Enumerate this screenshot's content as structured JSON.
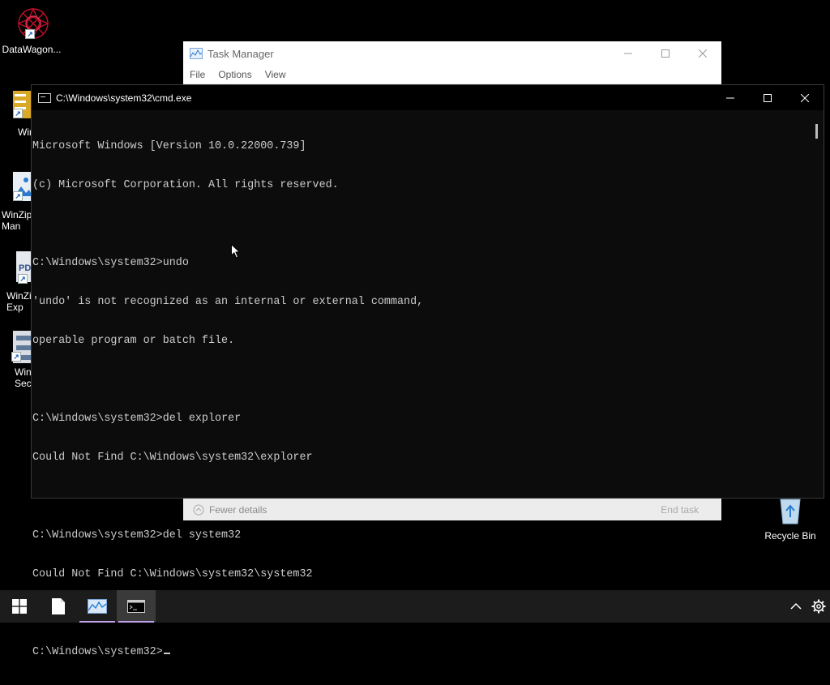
{
  "desktop": {
    "icons": [
      {
        "name": "datawagon",
        "label": "DataWagon..."
      },
      {
        "name": "winzip",
        "label": "Wir"
      },
      {
        "name": "winzip-image-manager",
        "label": "WinZip\nMan"
      },
      {
        "name": "winzip-pdf-express",
        "label": "WinZi\nExp"
      },
      {
        "name": "winzip-secure",
        "label": "Win\nSec"
      },
      {
        "name": "recycle-bin",
        "label": "Recycle Bin"
      }
    ]
  },
  "task_manager": {
    "title": "Task Manager",
    "menu": [
      "File",
      "Options",
      "View"
    ],
    "fewer_details": "Fewer details",
    "end_task": "End task"
  },
  "cmd": {
    "title": "C:\\Windows\\system32\\cmd.exe",
    "lines": [
      "Microsoft Windows [Version 10.0.22000.739]",
      "(c) Microsoft Corporation. All rights reserved.",
      "",
      "C:\\Windows\\system32>undo",
      "'undo' is not recognized as an internal or external command,",
      "operable program or batch file.",
      "",
      "C:\\Windows\\system32>del explorer",
      "Could Not Find C:\\Windows\\system32\\explorer",
      "",
      "C:\\Windows\\system32>del system32",
      "Could Not Find C:\\Windows\\system32\\system32",
      "",
      "C:\\Windows\\system32>"
    ]
  },
  "taskbar": {
    "items": [
      {
        "name": "start-button",
        "icon": "windows-logo-icon"
      },
      {
        "name": "taskbar-file",
        "icon": "file-icon"
      },
      {
        "name": "taskbar-task-manager",
        "icon": "task-manager-icon"
      },
      {
        "name": "taskbar-cmd",
        "icon": "cmd-icon"
      }
    ],
    "tray": [
      {
        "name": "tray-overflow-button",
        "icon": "chevron-up-icon"
      },
      {
        "name": "tray-settings-button",
        "icon": "gear-icon"
      }
    ]
  },
  "colors": {
    "console_bg": "#0c0c0c",
    "console_text": "#cccccc",
    "taskbar_bg": "#1c1c1c",
    "running_indicator": "#c0a0e8"
  }
}
